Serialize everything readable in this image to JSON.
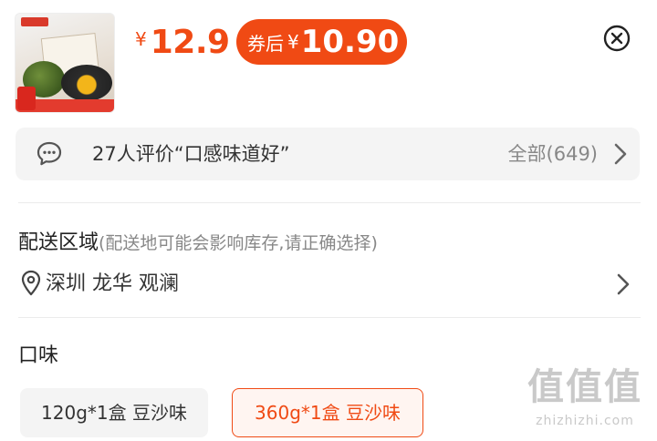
{
  "product": {
    "image_name": "mooncake-product-thumbnail",
    "price_symbol": "¥",
    "price": "12.9",
    "coupon_label": "券后",
    "coupon_symbol": "¥",
    "coupon_price": "10.90",
    "accent_color": "#f04a14"
  },
  "review": {
    "summary": "27人评价“口感味道好”",
    "all_label": "全部(649)"
  },
  "delivery": {
    "title": "配送区域",
    "hint": "(配送地可能会影响库存,请正确选择)",
    "location": "深圳 龙华 观澜"
  },
  "flavor": {
    "title": "口味",
    "options": [
      {
        "label": "120g*1盒 豆沙味",
        "selected": false
      },
      {
        "label": "360g*1盒 豆沙味",
        "selected": true
      }
    ]
  },
  "watermark": {
    "glyphs": "值值值",
    "url": "zhizhizhi.com"
  },
  "icons": {
    "close": "close-circle-icon",
    "review": "chat-bubble-icon",
    "location": "location-pin-icon",
    "chevron": "chevron-right-icon"
  }
}
